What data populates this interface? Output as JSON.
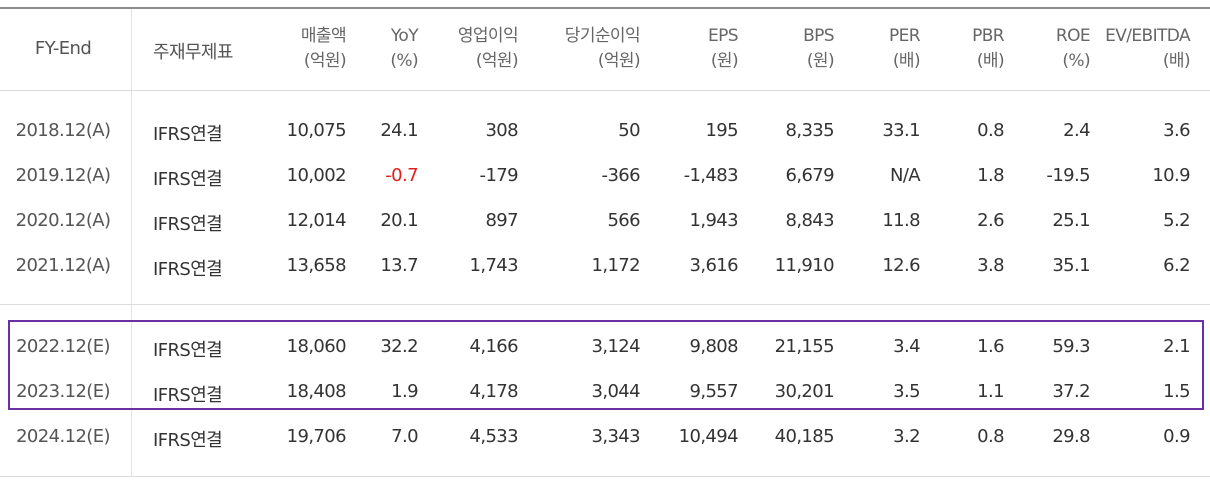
{
  "header": {
    "fy_end": "FY-End",
    "statement": "주재무제표",
    "sales": [
      "매출액",
      "(억원)"
    ],
    "yoy": [
      "YoY",
      "(%)"
    ],
    "op_income": [
      "영업이익",
      "(억원)"
    ],
    "net_income": [
      "당기순이익",
      "(억원)"
    ],
    "eps": [
      "EPS",
      "(원)"
    ],
    "bps": [
      "BPS",
      "(원)"
    ],
    "per": [
      "PER",
      "(배)"
    ],
    "pbr": [
      "PBR",
      "(배)"
    ],
    "roe": [
      "ROE",
      "(%)"
    ],
    "ev_ebitda": [
      "EV/EBITDA",
      "(배)"
    ]
  },
  "rows": [
    {
      "fy": "2018.12(A)",
      "stmt": "IFRS연결",
      "sales": "10,075",
      "yoy": "24.1",
      "op": "308",
      "net": "50",
      "eps": "195",
      "bps": "8,335",
      "per": "33.1",
      "pbr": "0.8",
      "roe": "2.4",
      "ev": "3.6"
    },
    {
      "fy": "2019.12(A)",
      "stmt": "IFRS연결",
      "sales": "10,002",
      "yoy": "-0.7",
      "op": "-179",
      "net": "-366",
      "eps": "-1,483",
      "bps": "6,679",
      "per": "N/A",
      "pbr": "1.8",
      "roe": "-19.5",
      "ev": "10.9"
    },
    {
      "fy": "2020.12(A)",
      "stmt": "IFRS연결",
      "sales": "12,014",
      "yoy": "20.1",
      "op": "897",
      "net": "566",
      "eps": "1,943",
      "bps": "8,843",
      "per": "11.8",
      "pbr": "2.6",
      "roe": "25.1",
      "ev": "5.2"
    },
    {
      "fy": "2021.12(A)",
      "stmt": "IFRS연결",
      "sales": "13,658",
      "yoy": "13.7",
      "op": "1,743",
      "net": "1,172",
      "eps": "3,616",
      "bps": "11,910",
      "per": "12.6",
      "pbr": "3.8",
      "roe": "35.1",
      "ev": "6.2"
    },
    {
      "fy": "2022.12(E)",
      "stmt": "IFRS연결",
      "sales": "18,060",
      "yoy": "32.2",
      "op": "4,166",
      "net": "3,124",
      "eps": "9,808",
      "bps": "21,155",
      "per": "3.4",
      "pbr": "1.6",
      "roe": "59.3",
      "ev": "2.1"
    },
    {
      "fy": "2023.12(E)",
      "stmt": "IFRS연결",
      "sales": "18,408",
      "yoy": "1.9",
      "op": "4,178",
      "net": "3,044",
      "eps": "9,557",
      "bps": "30,201",
      "per": "3.5",
      "pbr": "1.1",
      "roe": "37.2",
      "ev": "1.5"
    },
    {
      "fy": "2024.12(E)",
      "stmt": "IFRS연결",
      "sales": "19,706",
      "yoy": "7.0",
      "op": "4,533",
      "net": "3,343",
      "eps": "10,494",
      "bps": "40,185",
      "per": "3.2",
      "pbr": "0.8",
      "roe": "29.8",
      "ev": "0.9"
    }
  ],
  "colors": {
    "negative": "#e0201e",
    "highlight_border": "#6a2fa0"
  }
}
